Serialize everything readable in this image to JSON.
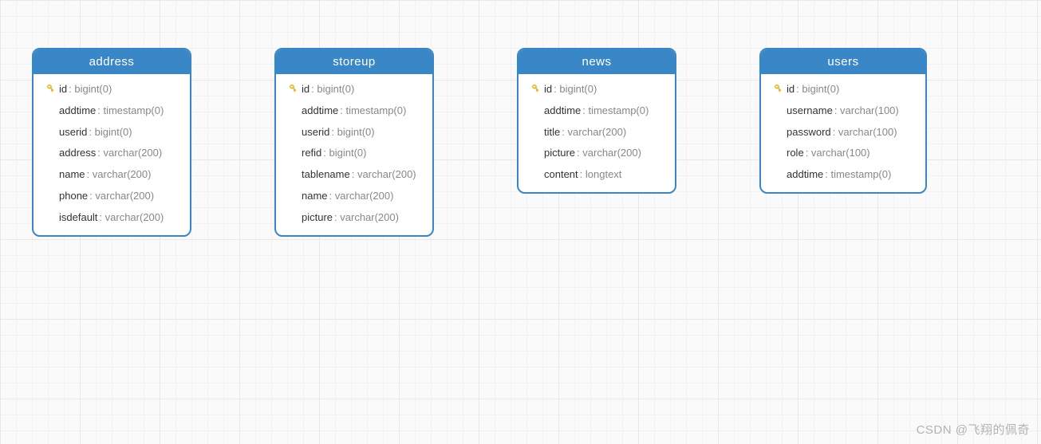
{
  "tables": [
    {
      "name": "address",
      "fields": [
        {
          "key": true,
          "name": "id",
          "type": "bigint(0)"
        },
        {
          "key": false,
          "name": "addtime",
          "type": "timestamp(0)"
        },
        {
          "key": false,
          "name": "userid",
          "type": "bigint(0)"
        },
        {
          "key": false,
          "name": "address",
          "type": "varchar(200)"
        },
        {
          "key": false,
          "name": "name",
          "type": "varchar(200)"
        },
        {
          "key": false,
          "name": "phone",
          "type": "varchar(200)"
        },
        {
          "key": false,
          "name": "isdefault",
          "type": "varchar(200)"
        }
      ]
    },
    {
      "name": "storeup",
      "fields": [
        {
          "key": true,
          "name": "id",
          "type": "bigint(0)"
        },
        {
          "key": false,
          "name": "addtime",
          "type": "timestamp(0)"
        },
        {
          "key": false,
          "name": "userid",
          "type": "bigint(0)"
        },
        {
          "key": false,
          "name": "refid",
          "type": "bigint(0)"
        },
        {
          "key": false,
          "name": "tablename",
          "type": "varchar(200)"
        },
        {
          "key": false,
          "name": "name",
          "type": "varchar(200)"
        },
        {
          "key": false,
          "name": "picture",
          "type": "varchar(200)"
        }
      ]
    },
    {
      "name": "news",
      "fields": [
        {
          "key": true,
          "name": "id",
          "type": "bigint(0)"
        },
        {
          "key": false,
          "name": "addtime",
          "type": "timestamp(0)"
        },
        {
          "key": false,
          "name": "title",
          "type": "varchar(200)"
        },
        {
          "key": false,
          "name": "picture",
          "type": "varchar(200)"
        },
        {
          "key": false,
          "name": "content",
          "type": "longtext"
        }
      ]
    },
    {
      "name": "users",
      "fields": [
        {
          "key": true,
          "name": "id",
          "type": "bigint(0)"
        },
        {
          "key": false,
          "name": "username",
          "type": "varchar(100)"
        },
        {
          "key": false,
          "name": "password",
          "type": "varchar(100)"
        },
        {
          "key": false,
          "name": "role",
          "type": "varchar(100)"
        },
        {
          "key": false,
          "name": "addtime",
          "type": "timestamp(0)"
        }
      ]
    }
  ],
  "watermark": "CSDN @飞翔的佩奇",
  "colors": {
    "header_bg": "#3a87c7",
    "border": "#3a87c7",
    "key_icon": "#f4c430"
  }
}
